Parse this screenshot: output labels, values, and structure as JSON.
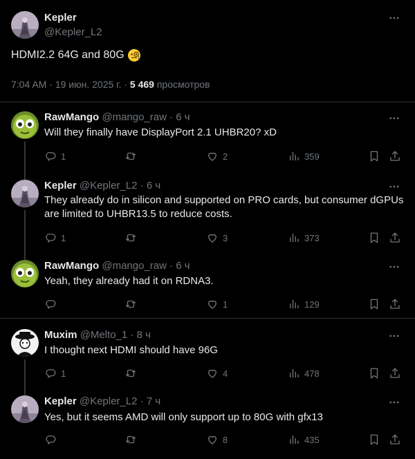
{
  "main": {
    "author_name": "Kepler",
    "author_handle": "@Kepler_L2",
    "text": "HDMI2.2 64G and 80G",
    "emoji": "monocle-face",
    "time": "7:04 AM",
    "dot": "·",
    "date": "19 июн. 2025 г.",
    "views_count": "5 469",
    "views_label": "просмотров"
  },
  "replies": [
    {
      "name": "RawMango",
      "handle": "@mango_raw",
      "time": "· 6 ч",
      "text": "Will they finally have DisplayPort 2.1 UHBR20? xD",
      "replies": "1",
      "retweets": "",
      "likes": "2",
      "views": "359",
      "avatar": "mango"
    },
    {
      "name": "Kepler",
      "handle": "@Kepler_L2",
      "time": "· 6 ч",
      "text": "They already do in silicon and supported on PRO cards, but consumer dGPUs are limited to UHBR13.5 to reduce costs.",
      "replies": "1",
      "retweets": "",
      "likes": "3",
      "views": "373",
      "avatar": "kepler"
    },
    {
      "name": "RawMango",
      "handle": "@mango_raw",
      "time": "· 6 ч",
      "text": "Yeah, they already had it on RDNA3.",
      "replies": "",
      "retweets": "",
      "likes": "1",
      "views": "129",
      "avatar": "mango"
    },
    {
      "name": "Muxim",
      "handle": "@Melto_1",
      "time": "· 8 ч",
      "text": "I thought next HDMI should have 96G",
      "replies": "1",
      "retweets": "",
      "likes": "4",
      "views": "478",
      "avatar": "muxim"
    },
    {
      "name": "Kepler",
      "handle": "@Kepler_L2",
      "time": "· 7 ч",
      "text": "Yes, but it seems AMD will only support up to 80G with gfx13",
      "replies": "",
      "retweets": "",
      "likes": "8",
      "views": "435",
      "avatar": "kepler"
    }
  ],
  "colors": {
    "background": "#000000",
    "text": "#e7e9ea",
    "secondary": "#71767b",
    "divider": "#2f3336"
  }
}
